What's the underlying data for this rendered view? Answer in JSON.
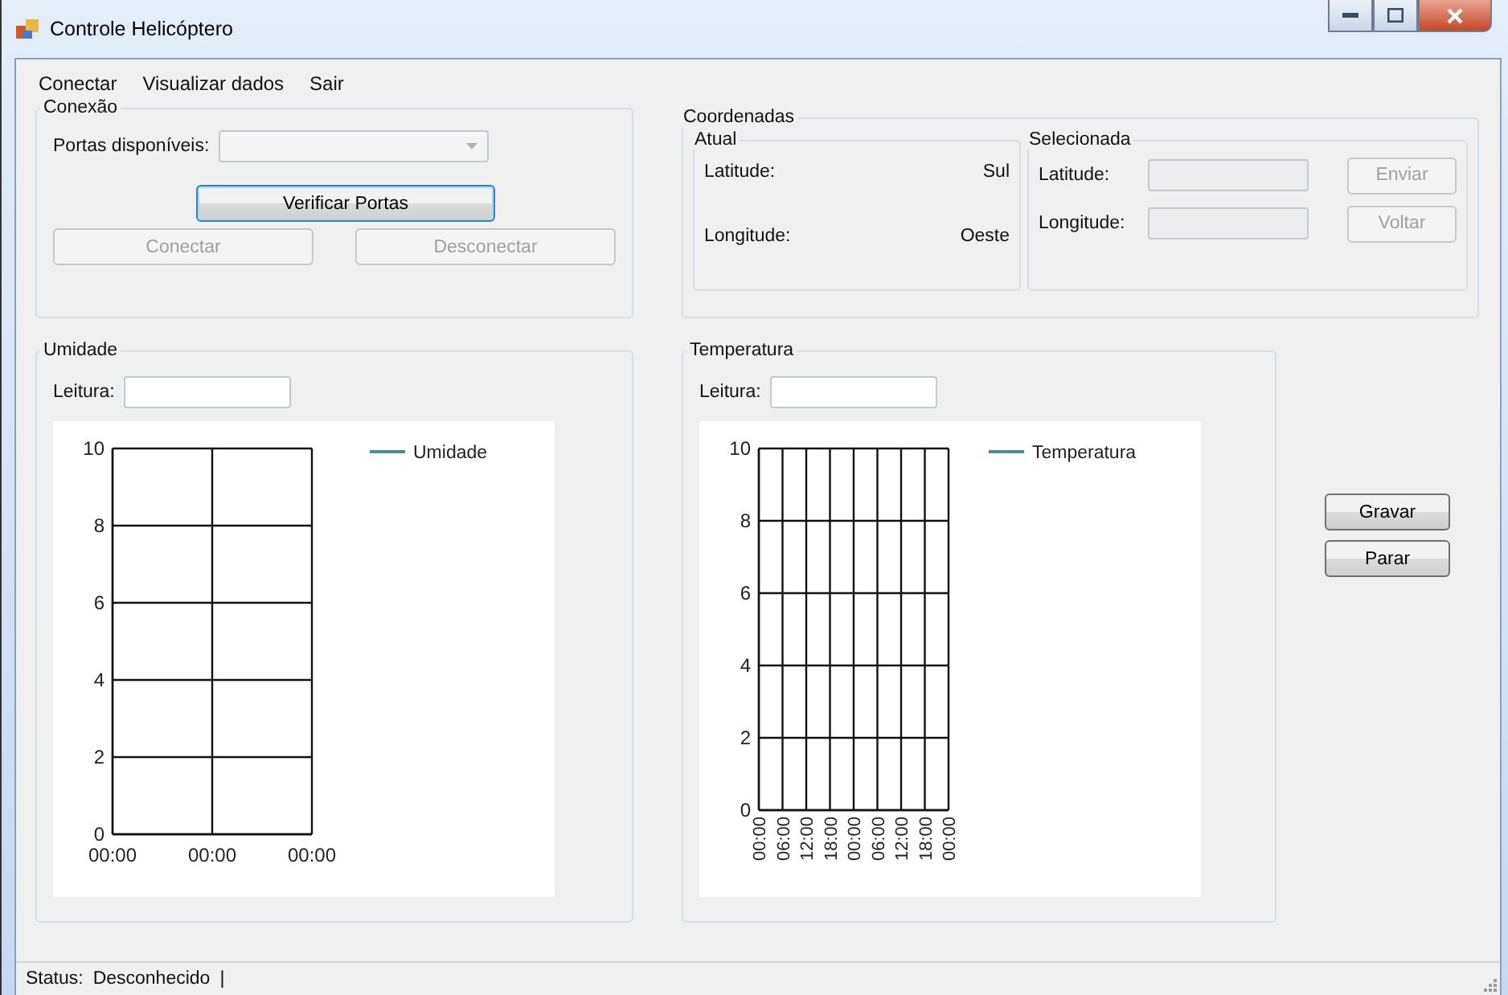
{
  "window": {
    "title": "Controle Helicóptero"
  },
  "menu": [
    {
      "label": "Conectar"
    },
    {
      "label": "Visualizar dados"
    },
    {
      "label": "Sair"
    }
  ],
  "conexao": {
    "title": "Conexão",
    "ports_label": "Portas disponíveis:",
    "ports_dropdown": {
      "disabled": true
    },
    "verify_button": {
      "label": "Verificar Portas",
      "disabled": false,
      "focused": true
    },
    "buttons": [
      {
        "label": "Conectar",
        "disabled": true
      },
      {
        "label": "Desconectar",
        "disabled": true
      }
    ]
  },
  "coordenadas": {
    "title": "Coordenadas",
    "atual": {
      "title": "Atual",
      "rows": [
        {
          "label": "Latitude:",
          "value": "Sul"
        },
        {
          "label": "Longitude:",
          "value": "Oeste"
        }
      ]
    },
    "selecionada": {
      "title": "Selecionada",
      "rows": [
        {
          "label": "Latitude:",
          "field_disabled": true,
          "button": "Enviar",
          "button_disabled": true
        },
        {
          "label": "Longitude:",
          "field_disabled": true,
          "button": "Voltar",
          "button_disabled": true
        }
      ]
    }
  },
  "umidade": {
    "title": "Umidade",
    "reading_label": "Leitura:",
    "chart_data": {
      "type": "line",
      "grid": true,
      "categories": [
        "00:00",
        "00:00",
        "00:00"
      ],
      "ylim": [
        0,
        10
      ],
      "yticks": [
        0,
        2,
        4,
        6,
        8,
        10
      ],
      "series": [
        {
          "name": "Umidade",
          "color": "#4f8a96",
          "values": [
            null,
            null,
            null
          ]
        }
      ]
    }
  },
  "temperatura": {
    "title": "Temperatura",
    "reading_label": "Leitura:",
    "chart_data": {
      "type": "line",
      "grid": true,
      "categories": [
        "00:00",
        "06:00",
        "12:00",
        "18:00",
        "00:00",
        "06:00",
        "12:00",
        "18:00",
        "00:00"
      ],
      "ylim": [
        0,
        10
      ],
      "yticks": [
        0,
        2,
        4,
        6,
        8,
        10
      ],
      "series": [
        {
          "name": "Temperatura",
          "color": "#4f8a96",
          "values": [
            null,
            null,
            null,
            null,
            null,
            null,
            null,
            null,
            null
          ]
        }
      ]
    }
  },
  "side_buttons": [
    {
      "label": "Gravar",
      "disabled": false
    },
    {
      "label": "Parar",
      "disabled": false
    }
  ],
  "status_bar": {
    "label": "Status:",
    "value": "Desconhecido",
    "separator": "|"
  }
}
